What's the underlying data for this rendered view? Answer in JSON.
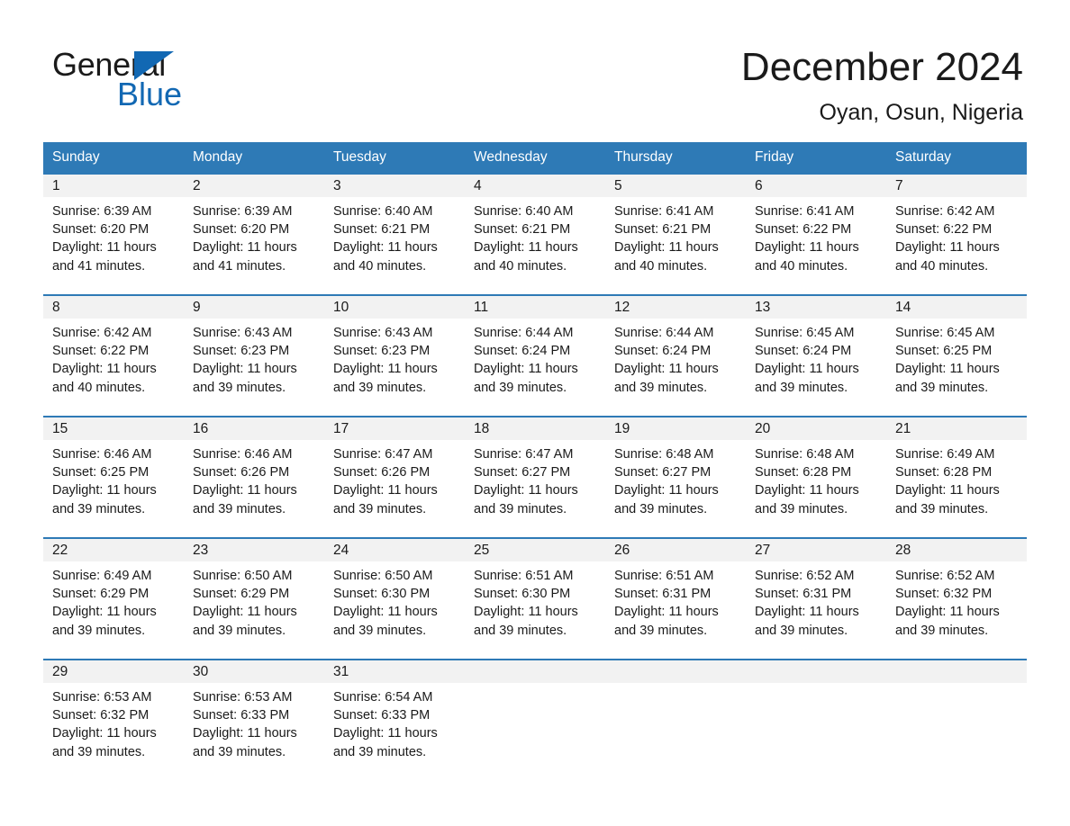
{
  "brand": {
    "name_dark": "General",
    "name_blue": "Blue",
    "triangle_color": "#1268b3",
    "logo_icon": "triangle-flag-icon"
  },
  "header": {
    "month_title": "December 2024",
    "location": "Oyan, Osun, Nigeria"
  },
  "theme": {
    "header_blue": "#2e7ab6",
    "row_divider_blue": "#2e7ab6",
    "daynum_strip": "#f2f2f2",
    "text": "#1a1a1a"
  },
  "weekday_headers": [
    "Sunday",
    "Monday",
    "Tuesday",
    "Wednesday",
    "Thursday",
    "Friday",
    "Saturday"
  ],
  "weeks": [
    [
      {
        "day": "1",
        "sunrise": "Sunrise: 6:39 AM",
        "sunset": "Sunset: 6:20 PM",
        "daylight1": "Daylight: 11 hours",
        "daylight2": "and 41 minutes."
      },
      {
        "day": "2",
        "sunrise": "Sunrise: 6:39 AM",
        "sunset": "Sunset: 6:20 PM",
        "daylight1": "Daylight: 11 hours",
        "daylight2": "and 41 minutes."
      },
      {
        "day": "3",
        "sunrise": "Sunrise: 6:40 AM",
        "sunset": "Sunset: 6:21 PM",
        "daylight1": "Daylight: 11 hours",
        "daylight2": "and 40 minutes."
      },
      {
        "day": "4",
        "sunrise": "Sunrise: 6:40 AM",
        "sunset": "Sunset: 6:21 PM",
        "daylight1": "Daylight: 11 hours",
        "daylight2": "and 40 minutes."
      },
      {
        "day": "5",
        "sunrise": "Sunrise: 6:41 AM",
        "sunset": "Sunset: 6:21 PM",
        "daylight1": "Daylight: 11 hours",
        "daylight2": "and 40 minutes."
      },
      {
        "day": "6",
        "sunrise": "Sunrise: 6:41 AM",
        "sunset": "Sunset: 6:22 PM",
        "daylight1": "Daylight: 11 hours",
        "daylight2": "and 40 minutes."
      },
      {
        "day": "7",
        "sunrise": "Sunrise: 6:42 AM",
        "sunset": "Sunset: 6:22 PM",
        "daylight1": "Daylight: 11 hours",
        "daylight2": "and 40 minutes."
      }
    ],
    [
      {
        "day": "8",
        "sunrise": "Sunrise: 6:42 AM",
        "sunset": "Sunset: 6:22 PM",
        "daylight1": "Daylight: 11 hours",
        "daylight2": "and 40 minutes."
      },
      {
        "day": "9",
        "sunrise": "Sunrise: 6:43 AM",
        "sunset": "Sunset: 6:23 PM",
        "daylight1": "Daylight: 11 hours",
        "daylight2": "and 39 minutes."
      },
      {
        "day": "10",
        "sunrise": "Sunrise: 6:43 AM",
        "sunset": "Sunset: 6:23 PM",
        "daylight1": "Daylight: 11 hours",
        "daylight2": "and 39 minutes."
      },
      {
        "day": "11",
        "sunrise": "Sunrise: 6:44 AM",
        "sunset": "Sunset: 6:24 PM",
        "daylight1": "Daylight: 11 hours",
        "daylight2": "and 39 minutes."
      },
      {
        "day": "12",
        "sunrise": "Sunrise: 6:44 AM",
        "sunset": "Sunset: 6:24 PM",
        "daylight1": "Daylight: 11 hours",
        "daylight2": "and 39 minutes."
      },
      {
        "day": "13",
        "sunrise": "Sunrise: 6:45 AM",
        "sunset": "Sunset: 6:24 PM",
        "daylight1": "Daylight: 11 hours",
        "daylight2": "and 39 minutes."
      },
      {
        "day": "14",
        "sunrise": "Sunrise: 6:45 AM",
        "sunset": "Sunset: 6:25 PM",
        "daylight1": "Daylight: 11 hours",
        "daylight2": "and 39 minutes."
      }
    ],
    [
      {
        "day": "15",
        "sunrise": "Sunrise: 6:46 AM",
        "sunset": "Sunset: 6:25 PM",
        "daylight1": "Daylight: 11 hours",
        "daylight2": "and 39 minutes."
      },
      {
        "day": "16",
        "sunrise": "Sunrise: 6:46 AM",
        "sunset": "Sunset: 6:26 PM",
        "daylight1": "Daylight: 11 hours",
        "daylight2": "and 39 minutes."
      },
      {
        "day": "17",
        "sunrise": "Sunrise: 6:47 AM",
        "sunset": "Sunset: 6:26 PM",
        "daylight1": "Daylight: 11 hours",
        "daylight2": "and 39 minutes."
      },
      {
        "day": "18",
        "sunrise": "Sunrise: 6:47 AM",
        "sunset": "Sunset: 6:27 PM",
        "daylight1": "Daylight: 11 hours",
        "daylight2": "and 39 minutes."
      },
      {
        "day": "19",
        "sunrise": "Sunrise: 6:48 AM",
        "sunset": "Sunset: 6:27 PM",
        "daylight1": "Daylight: 11 hours",
        "daylight2": "and 39 minutes."
      },
      {
        "day": "20",
        "sunrise": "Sunrise: 6:48 AM",
        "sunset": "Sunset: 6:28 PM",
        "daylight1": "Daylight: 11 hours",
        "daylight2": "and 39 minutes."
      },
      {
        "day": "21",
        "sunrise": "Sunrise: 6:49 AM",
        "sunset": "Sunset: 6:28 PM",
        "daylight1": "Daylight: 11 hours",
        "daylight2": "and 39 minutes."
      }
    ],
    [
      {
        "day": "22",
        "sunrise": "Sunrise: 6:49 AM",
        "sunset": "Sunset: 6:29 PM",
        "daylight1": "Daylight: 11 hours",
        "daylight2": "and 39 minutes."
      },
      {
        "day": "23",
        "sunrise": "Sunrise: 6:50 AM",
        "sunset": "Sunset: 6:29 PM",
        "daylight1": "Daylight: 11 hours",
        "daylight2": "and 39 minutes."
      },
      {
        "day": "24",
        "sunrise": "Sunrise: 6:50 AM",
        "sunset": "Sunset: 6:30 PM",
        "daylight1": "Daylight: 11 hours",
        "daylight2": "and 39 minutes."
      },
      {
        "day": "25",
        "sunrise": "Sunrise: 6:51 AM",
        "sunset": "Sunset: 6:30 PM",
        "daylight1": "Daylight: 11 hours",
        "daylight2": "and 39 minutes."
      },
      {
        "day": "26",
        "sunrise": "Sunrise: 6:51 AM",
        "sunset": "Sunset: 6:31 PM",
        "daylight1": "Daylight: 11 hours",
        "daylight2": "and 39 minutes."
      },
      {
        "day": "27",
        "sunrise": "Sunrise: 6:52 AM",
        "sunset": "Sunset: 6:31 PM",
        "daylight1": "Daylight: 11 hours",
        "daylight2": "and 39 minutes."
      },
      {
        "day": "28",
        "sunrise": "Sunrise: 6:52 AM",
        "sunset": "Sunset: 6:32 PM",
        "daylight1": "Daylight: 11 hours",
        "daylight2": "and 39 minutes."
      }
    ],
    [
      {
        "day": "29",
        "sunrise": "Sunrise: 6:53 AM",
        "sunset": "Sunset: 6:32 PM",
        "daylight1": "Daylight: 11 hours",
        "daylight2": "and 39 minutes."
      },
      {
        "day": "30",
        "sunrise": "Sunrise: 6:53 AM",
        "sunset": "Sunset: 6:33 PM",
        "daylight1": "Daylight: 11 hours",
        "daylight2": "and 39 minutes."
      },
      {
        "day": "31",
        "sunrise": "Sunrise: 6:54 AM",
        "sunset": "Sunset: 6:33 PM",
        "daylight1": "Daylight: 11 hours",
        "daylight2": "and 39 minutes."
      },
      {
        "day": "",
        "sunrise": "",
        "sunset": "",
        "daylight1": "",
        "daylight2": ""
      },
      {
        "day": "",
        "sunrise": "",
        "sunset": "",
        "daylight1": "",
        "daylight2": ""
      },
      {
        "day": "",
        "sunrise": "",
        "sunset": "",
        "daylight1": "",
        "daylight2": ""
      },
      {
        "day": "",
        "sunrise": "",
        "sunset": "",
        "daylight1": "",
        "daylight2": ""
      }
    ]
  ]
}
